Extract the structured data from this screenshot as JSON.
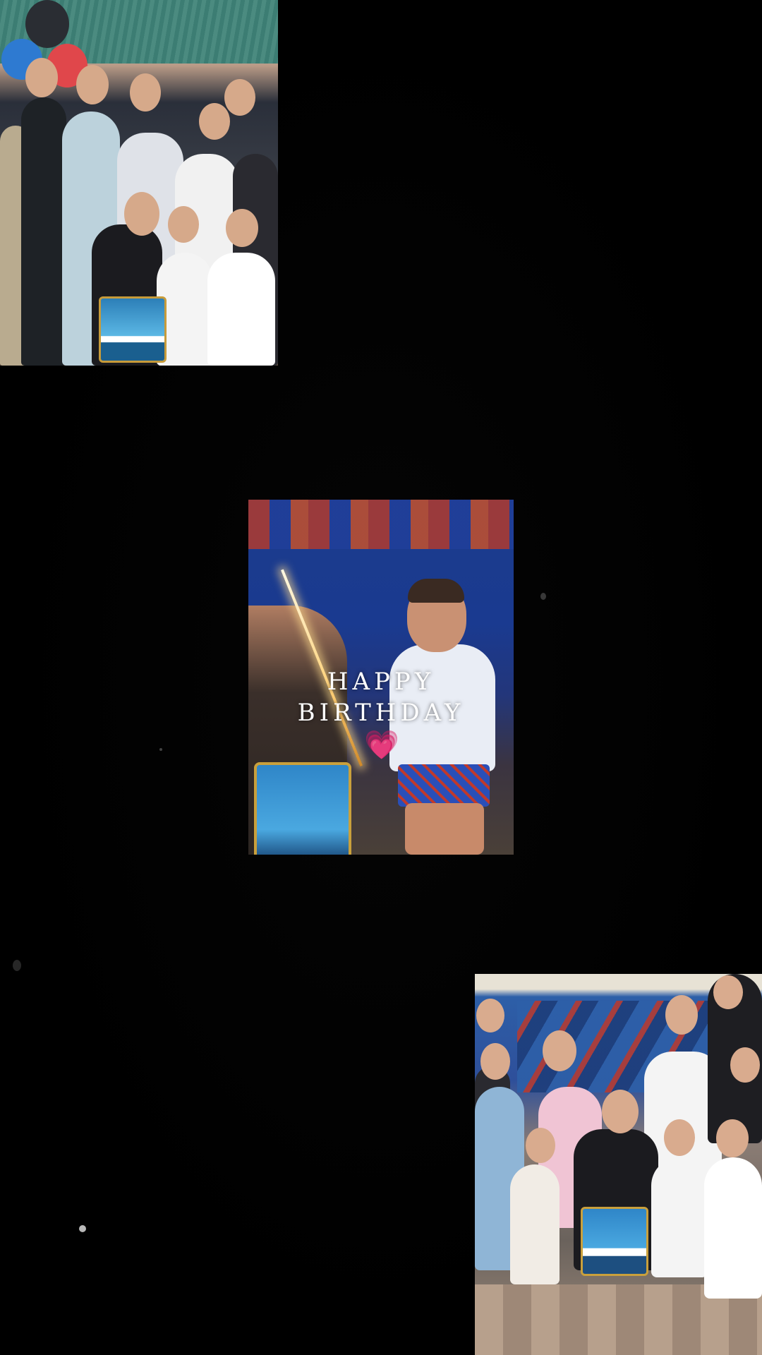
{
  "story": {
    "overlay_line1": "HAPPY",
    "overlay_line2": "BIRTHDAY",
    "sticker_emoji": "💗",
    "sticker_name": "pink-heart-icon"
  },
  "photos": [
    {
      "id": "group-photo-top-left",
      "subject": "group of children with birthday cake"
    },
    {
      "id": "birthday-boy-video-frame",
      "subject": "boy with sparkler cake"
    },
    {
      "id": "group-photo-bottom-right",
      "subject": "group of children with birthday cake"
    }
  ],
  "colors": {
    "background": "#000000",
    "overlay_text": "#ffffff",
    "heart": "#ff4fa3"
  }
}
